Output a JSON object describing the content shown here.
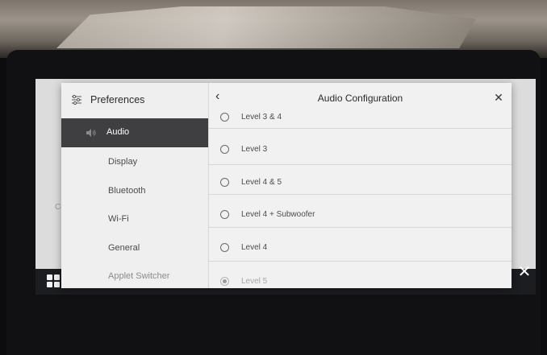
{
  "background": {
    "stub_text": "Co"
  },
  "sidebar": {
    "title": "Preferences",
    "items": [
      {
        "label": "Audio",
        "active": true
      },
      {
        "label": "Display"
      },
      {
        "label": "Bluetooth"
      },
      {
        "label": "Wi-Fi"
      },
      {
        "label": "General"
      },
      {
        "label": "Applet Switcher"
      }
    ]
  },
  "dialog": {
    "title": "Audio Configuration",
    "back_icon": "chevron-left-icon",
    "close_icon": "close-icon",
    "options": [
      {
        "label": "Level 3 & 4",
        "selected": false
      },
      {
        "label": "Level 3",
        "selected": false
      },
      {
        "label": "Level 4 & 5",
        "selected": false
      },
      {
        "label": "Level 4 + Subwoofer",
        "selected": false
      },
      {
        "label": "Level 4",
        "selected": false
      },
      {
        "label": "Level 5",
        "selected": true
      }
    ]
  },
  "colors": {
    "active_item_bg": "#3f3f42",
    "dialog_bg": "#f1f1f1",
    "home_bar_bg": "#1c1d20"
  }
}
